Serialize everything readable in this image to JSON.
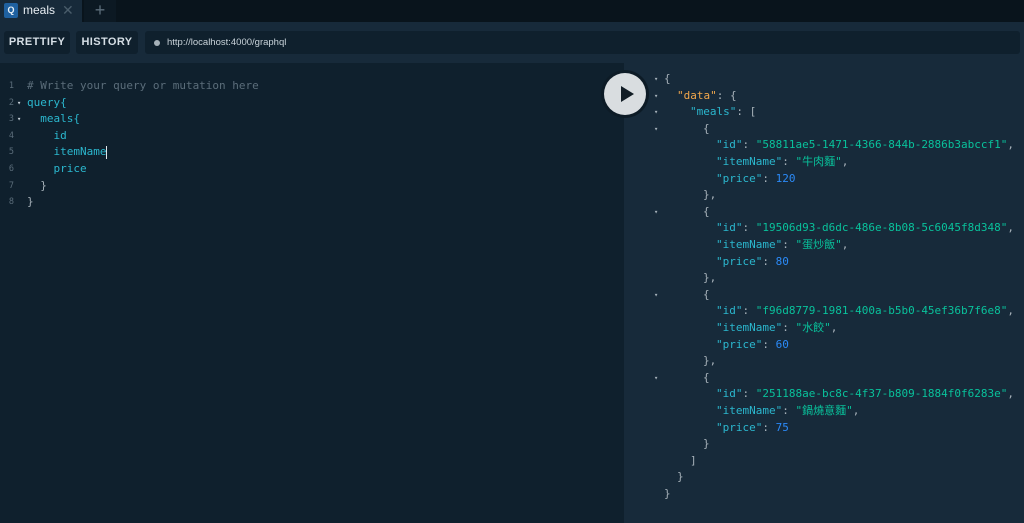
{
  "tabs": {
    "active": {
      "icon": "Q",
      "title": "meals",
      "close": "✕"
    },
    "new_tab": "+"
  },
  "toolbar": {
    "prettify_label": "PRETTIFY",
    "history_label": "HISTORY",
    "endpoint": "http://localhost:4000/graphql"
  },
  "editor": {
    "lines": [
      {
        "num": "1",
        "fold": "",
        "text": "# Write your query or mutation here",
        "kind": "comment"
      },
      {
        "num": "2",
        "fold": "▾",
        "text": "query{",
        "kind": "kw"
      },
      {
        "num": "3",
        "fold": "▾",
        "text": "  meals{",
        "kind": "field"
      },
      {
        "num": "4",
        "fold": "",
        "text": "    id",
        "kind": "field"
      },
      {
        "num": "5",
        "fold": "",
        "text": "    itemName",
        "kind": "field"
      },
      {
        "num": "6",
        "fold": "",
        "text": "    price",
        "kind": "field"
      },
      {
        "num": "7",
        "fold": "",
        "text": "  }",
        "kind": "punct"
      },
      {
        "num": "8",
        "fold": "",
        "text": "}",
        "kind": "punct"
      }
    ]
  },
  "run_button": {
    "icon": "play-icon"
  },
  "result": {
    "lines": [
      {
        "fold": "▾",
        "indent": 0,
        "parts": [
          [
            "punct",
            "{"
          ]
        ]
      },
      {
        "fold": "▾",
        "indent": 1,
        "parts": [
          [
            "data",
            "\"data\""
          ],
          [
            "punct",
            ": {"
          ]
        ]
      },
      {
        "fold": "▾",
        "indent": 2,
        "parts": [
          [
            "key",
            "\"meals\""
          ],
          [
            "punct",
            ": ["
          ]
        ]
      },
      {
        "fold": "▾",
        "indent": 3,
        "parts": [
          [
            "punct",
            "{"
          ]
        ]
      },
      {
        "fold": "",
        "indent": 4,
        "parts": [
          [
            "key",
            "\"id\""
          ],
          [
            "punct",
            ": "
          ],
          [
            "str",
            "\"58811ae5-1471-4366-844b-2886b3abccf1\""
          ],
          [
            "punct",
            ","
          ]
        ]
      },
      {
        "fold": "",
        "indent": 4,
        "parts": [
          [
            "key",
            "\"itemName\""
          ],
          [
            "punct",
            ": "
          ],
          [
            "str",
            "\"牛肉麵\""
          ],
          [
            "punct",
            ","
          ]
        ]
      },
      {
        "fold": "",
        "indent": 4,
        "parts": [
          [
            "key",
            "\"price\""
          ],
          [
            "punct",
            ": "
          ],
          [
            "num",
            "120"
          ]
        ]
      },
      {
        "fold": "",
        "indent": 3,
        "parts": [
          [
            "punct",
            "},"
          ]
        ]
      },
      {
        "fold": "▾",
        "indent": 3,
        "parts": [
          [
            "punct",
            "{"
          ]
        ]
      },
      {
        "fold": "",
        "indent": 4,
        "parts": [
          [
            "key",
            "\"id\""
          ],
          [
            "punct",
            ": "
          ],
          [
            "str",
            "\"19506d93-d6dc-486e-8b08-5c6045f8d348\""
          ],
          [
            "punct",
            ","
          ]
        ]
      },
      {
        "fold": "",
        "indent": 4,
        "parts": [
          [
            "key",
            "\"itemName\""
          ],
          [
            "punct",
            ": "
          ],
          [
            "str",
            "\"蛋炒飯\""
          ],
          [
            "punct",
            ","
          ]
        ]
      },
      {
        "fold": "",
        "indent": 4,
        "parts": [
          [
            "key",
            "\"price\""
          ],
          [
            "punct",
            ": "
          ],
          [
            "num",
            "80"
          ]
        ]
      },
      {
        "fold": "",
        "indent": 3,
        "parts": [
          [
            "punct",
            "},"
          ]
        ]
      },
      {
        "fold": "▾",
        "indent": 3,
        "parts": [
          [
            "punct",
            "{"
          ]
        ]
      },
      {
        "fold": "",
        "indent": 4,
        "parts": [
          [
            "key",
            "\"id\""
          ],
          [
            "punct",
            ": "
          ],
          [
            "str",
            "\"f96d8779-1981-400a-b5b0-45ef36b7f6e8\""
          ],
          [
            "punct",
            ","
          ]
        ]
      },
      {
        "fold": "",
        "indent": 4,
        "parts": [
          [
            "key",
            "\"itemName\""
          ],
          [
            "punct",
            ": "
          ],
          [
            "str",
            "\"水餃\""
          ],
          [
            "punct",
            ","
          ]
        ]
      },
      {
        "fold": "",
        "indent": 4,
        "parts": [
          [
            "key",
            "\"price\""
          ],
          [
            "punct",
            ": "
          ],
          [
            "num",
            "60"
          ]
        ]
      },
      {
        "fold": "",
        "indent": 3,
        "parts": [
          [
            "punct",
            "},"
          ]
        ]
      },
      {
        "fold": "▾",
        "indent": 3,
        "parts": [
          [
            "punct",
            "{"
          ]
        ]
      },
      {
        "fold": "",
        "indent": 4,
        "parts": [
          [
            "key",
            "\"id\""
          ],
          [
            "punct",
            ": "
          ],
          [
            "str",
            "\"251188ae-bc8c-4f37-b809-1884f0f6283e\""
          ],
          [
            "punct",
            ","
          ]
        ]
      },
      {
        "fold": "",
        "indent": 4,
        "parts": [
          [
            "key",
            "\"itemName\""
          ],
          [
            "punct",
            ": "
          ],
          [
            "str",
            "\"鍋燒意麵\""
          ],
          [
            "punct",
            ","
          ]
        ]
      },
      {
        "fold": "",
        "indent": 4,
        "parts": [
          [
            "key",
            "\"price\""
          ],
          [
            "punct",
            ": "
          ],
          [
            "num",
            "75"
          ]
        ]
      },
      {
        "fold": "",
        "indent": 3,
        "parts": [
          [
            "punct",
            "}"
          ]
        ]
      },
      {
        "fold": "",
        "indent": 2,
        "parts": [
          [
            "punct",
            "]"
          ]
        ]
      },
      {
        "fold": "",
        "indent": 1,
        "parts": [
          [
            "punct",
            "}"
          ]
        ]
      },
      {
        "fold": "",
        "indent": 0,
        "parts": [
          [
            "punct",
            "}"
          ]
        ]
      }
    ]
  }
}
